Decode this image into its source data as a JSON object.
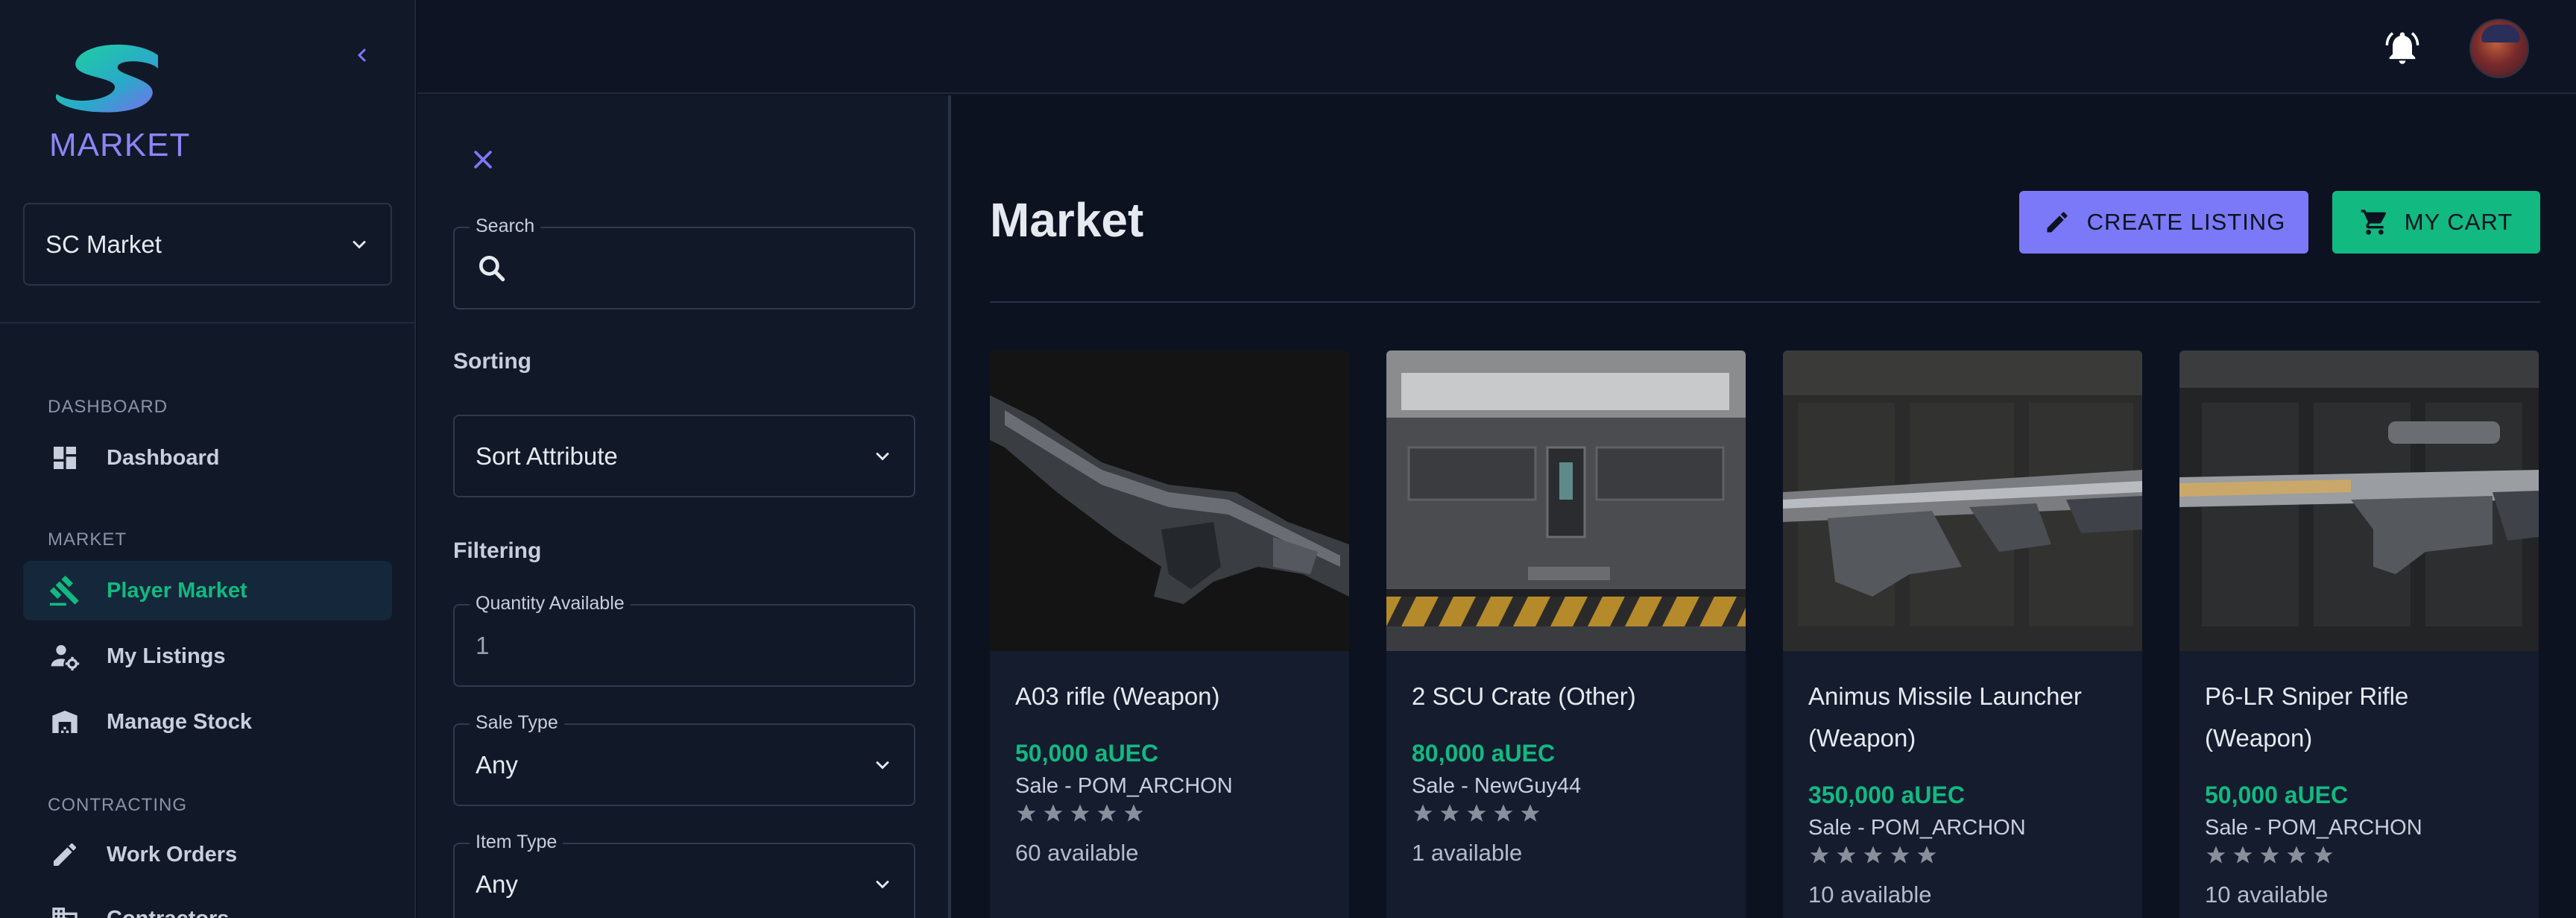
{
  "sidebar": {
    "logo_text": "MARKET",
    "org_selector": "SC Market",
    "sections": [
      {
        "label": "DASHBOARD",
        "items": [
          {
            "label": "Dashboard",
            "icon": "dashboard-icon",
            "active": false
          }
        ]
      },
      {
        "label": "MARKET",
        "items": [
          {
            "label": "Player Market",
            "icon": "gavel-icon",
            "active": true
          },
          {
            "label": "My Listings",
            "icon": "person-gear-icon",
            "active": false
          },
          {
            "label": "Manage Stock",
            "icon": "warehouse-icon",
            "active": false
          }
        ]
      },
      {
        "label": "CONTRACTING",
        "items": [
          {
            "label": "Work Orders",
            "icon": "pencil-icon",
            "active": false
          },
          {
            "label": "Contractors",
            "icon": "building-icon",
            "active": false
          }
        ]
      }
    ]
  },
  "filters": {
    "search_label": "Search",
    "sorting_title": "Sorting",
    "sort_value": "Sort Attribute",
    "filtering_title": "Filtering",
    "quantity_label": "Quantity Available",
    "quantity_value": "1",
    "sale_type_label": "Sale Type",
    "sale_type_value": "Any",
    "item_type_label": "Item Type",
    "item_type_value": "Any"
  },
  "main": {
    "title": "Market",
    "create_listing": "CREATE LISTING",
    "my_cart": "MY CART"
  },
  "listings": [
    {
      "title": "A03 rifle (Weapon)",
      "price": "50,000 aUEC",
      "seller": "Sale - POM_ARCHON",
      "rating": 5,
      "available": "60 available"
    },
    {
      "title": "2 SCU Crate (Other)",
      "price": "80,000 aUEC",
      "seller": "Sale - NewGuy44",
      "rating": 5,
      "available": "1 available"
    },
    {
      "title": "Animus Missile Launcher (Weapon)",
      "price": "350,000 aUEC",
      "seller": "Sale - POM_ARCHON",
      "rating": 5,
      "available": "10 available"
    },
    {
      "title": "P6-LR Sniper Rifle (Weapon)",
      "price": "50,000 aUEC",
      "seller": "Sale - POM_ARCHON",
      "rating": 5,
      "available": "10 available"
    }
  ],
  "colors": {
    "accent": "#7b79f7",
    "success": "#12b981",
    "background": "#0d1220",
    "panel": "#111828"
  }
}
